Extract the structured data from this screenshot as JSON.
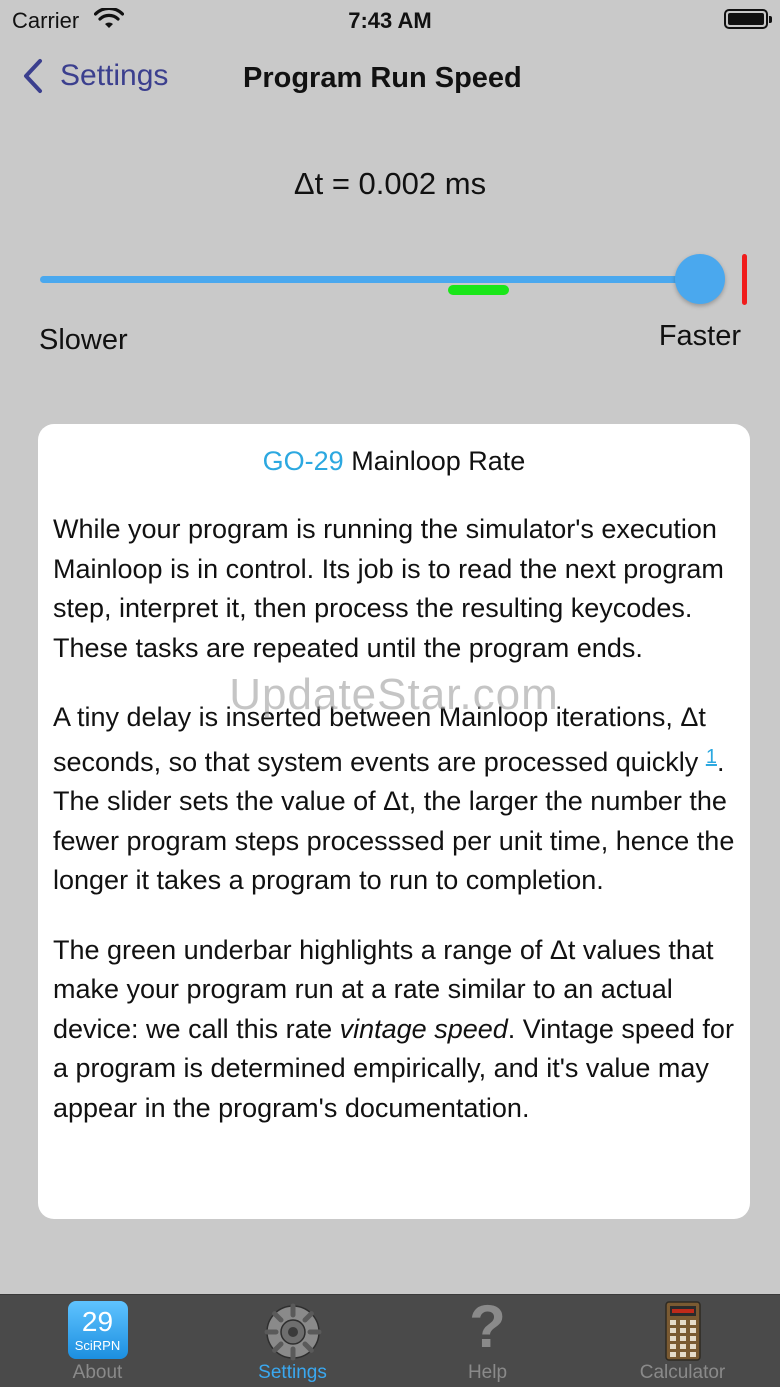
{
  "status_bar": {
    "carrier": "Carrier",
    "time": "7:43 AM"
  },
  "nav": {
    "back_label": "Settings",
    "title": "Program Run Speed"
  },
  "speed": {
    "delta_label": "Δt = 0.002 ms",
    "slower_label": "Slower",
    "faster_label": "Faster",
    "slider_value_fraction": 0.97,
    "vintage_range_fraction": [
      0.6,
      0.69
    ]
  },
  "card": {
    "title_accent": "GO-29",
    "title_rest": " Mainloop Rate",
    "para1": "While your program is running the simulator's execution Mainloop is in control. Its job is to read the next program step, interpret it, then process the resulting keycodes. These tasks are repeated until the program ends.",
    "para2_before": "A tiny delay is inserted between Mainloop iterations, Δt seconds, so that system events are processed quickly ",
    "para2_footnote": "1",
    "para2_after": ". The slider sets the value of Δt, the larger the number the fewer program steps processsed per unit time, hence the longer it takes a program to run to completion.",
    "para3_before": "The green underbar highlights a range of Δt values that make your program run at a rate similar to an actual device: we call this rate ",
    "para3_em": "vintage speed",
    "para3_after": ". Vintage speed for a program is determined empirically, and it's value may appear in the program's documentation.",
    "watermark": "UpdateStar.com"
  },
  "tabs": [
    {
      "label": "About",
      "icon": "sci-rpn-29-icon",
      "icon_num": "29",
      "icon_sub": "SciRPN",
      "active": false
    },
    {
      "label": "Settings",
      "icon": "gear-icon",
      "active": true
    },
    {
      "label": "Help",
      "icon": "question-mark-icon",
      "icon_glyph": "?",
      "active": false
    },
    {
      "label": "Calculator",
      "icon": "calculator-icon",
      "active": false
    }
  ],
  "colors": {
    "background": "#c9c9c9",
    "accent_blue": "#4aa8ee",
    "link_blue": "#2ca8e0",
    "vintage_green": "#19e619",
    "max_red": "#f01c1c",
    "nav_back": "#3b3f8e",
    "tabbar": "#4a4a4a"
  }
}
